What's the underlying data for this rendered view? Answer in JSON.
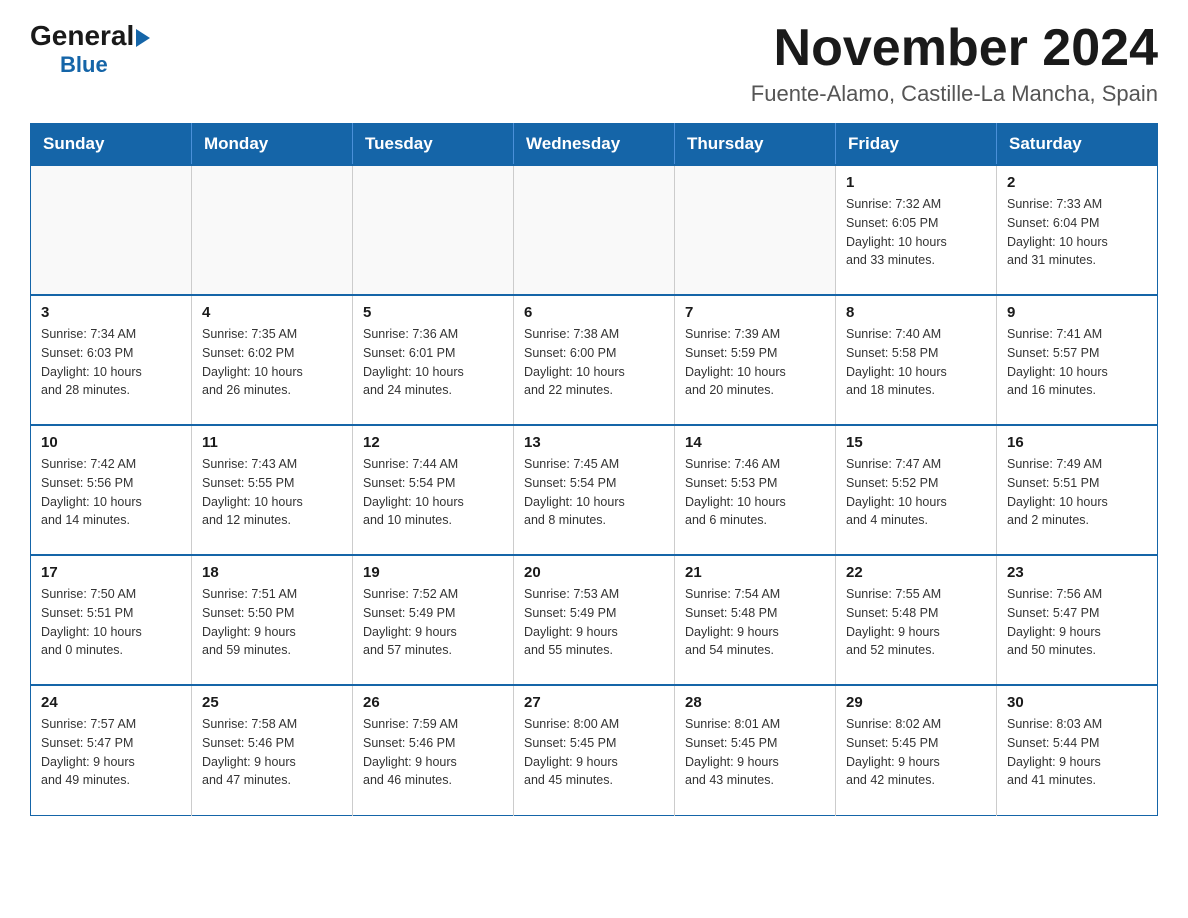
{
  "logo": {
    "general": "General",
    "blue": "Blue"
  },
  "header": {
    "title": "November 2024",
    "subtitle": "Fuente-Alamo, Castille-La Mancha, Spain"
  },
  "weekdays": [
    "Sunday",
    "Monday",
    "Tuesday",
    "Wednesday",
    "Thursday",
    "Friday",
    "Saturday"
  ],
  "weeks": [
    {
      "days": [
        {
          "num": "",
          "info": ""
        },
        {
          "num": "",
          "info": ""
        },
        {
          "num": "",
          "info": ""
        },
        {
          "num": "",
          "info": ""
        },
        {
          "num": "",
          "info": ""
        },
        {
          "num": "1",
          "info": "Sunrise: 7:32 AM\nSunset: 6:05 PM\nDaylight: 10 hours\nand 33 minutes."
        },
        {
          "num": "2",
          "info": "Sunrise: 7:33 AM\nSunset: 6:04 PM\nDaylight: 10 hours\nand 31 minutes."
        }
      ]
    },
    {
      "days": [
        {
          "num": "3",
          "info": "Sunrise: 7:34 AM\nSunset: 6:03 PM\nDaylight: 10 hours\nand 28 minutes."
        },
        {
          "num": "4",
          "info": "Sunrise: 7:35 AM\nSunset: 6:02 PM\nDaylight: 10 hours\nand 26 minutes."
        },
        {
          "num": "5",
          "info": "Sunrise: 7:36 AM\nSunset: 6:01 PM\nDaylight: 10 hours\nand 24 minutes."
        },
        {
          "num": "6",
          "info": "Sunrise: 7:38 AM\nSunset: 6:00 PM\nDaylight: 10 hours\nand 22 minutes."
        },
        {
          "num": "7",
          "info": "Sunrise: 7:39 AM\nSunset: 5:59 PM\nDaylight: 10 hours\nand 20 minutes."
        },
        {
          "num": "8",
          "info": "Sunrise: 7:40 AM\nSunset: 5:58 PM\nDaylight: 10 hours\nand 18 minutes."
        },
        {
          "num": "9",
          "info": "Sunrise: 7:41 AM\nSunset: 5:57 PM\nDaylight: 10 hours\nand 16 minutes."
        }
      ]
    },
    {
      "days": [
        {
          "num": "10",
          "info": "Sunrise: 7:42 AM\nSunset: 5:56 PM\nDaylight: 10 hours\nand 14 minutes."
        },
        {
          "num": "11",
          "info": "Sunrise: 7:43 AM\nSunset: 5:55 PM\nDaylight: 10 hours\nand 12 minutes."
        },
        {
          "num": "12",
          "info": "Sunrise: 7:44 AM\nSunset: 5:54 PM\nDaylight: 10 hours\nand 10 minutes."
        },
        {
          "num": "13",
          "info": "Sunrise: 7:45 AM\nSunset: 5:54 PM\nDaylight: 10 hours\nand 8 minutes."
        },
        {
          "num": "14",
          "info": "Sunrise: 7:46 AM\nSunset: 5:53 PM\nDaylight: 10 hours\nand 6 minutes."
        },
        {
          "num": "15",
          "info": "Sunrise: 7:47 AM\nSunset: 5:52 PM\nDaylight: 10 hours\nand 4 minutes."
        },
        {
          "num": "16",
          "info": "Sunrise: 7:49 AM\nSunset: 5:51 PM\nDaylight: 10 hours\nand 2 minutes."
        }
      ]
    },
    {
      "days": [
        {
          "num": "17",
          "info": "Sunrise: 7:50 AM\nSunset: 5:51 PM\nDaylight: 10 hours\nand 0 minutes."
        },
        {
          "num": "18",
          "info": "Sunrise: 7:51 AM\nSunset: 5:50 PM\nDaylight: 9 hours\nand 59 minutes."
        },
        {
          "num": "19",
          "info": "Sunrise: 7:52 AM\nSunset: 5:49 PM\nDaylight: 9 hours\nand 57 minutes."
        },
        {
          "num": "20",
          "info": "Sunrise: 7:53 AM\nSunset: 5:49 PM\nDaylight: 9 hours\nand 55 minutes."
        },
        {
          "num": "21",
          "info": "Sunrise: 7:54 AM\nSunset: 5:48 PM\nDaylight: 9 hours\nand 54 minutes."
        },
        {
          "num": "22",
          "info": "Sunrise: 7:55 AM\nSunset: 5:48 PM\nDaylight: 9 hours\nand 52 minutes."
        },
        {
          "num": "23",
          "info": "Sunrise: 7:56 AM\nSunset: 5:47 PM\nDaylight: 9 hours\nand 50 minutes."
        }
      ]
    },
    {
      "days": [
        {
          "num": "24",
          "info": "Sunrise: 7:57 AM\nSunset: 5:47 PM\nDaylight: 9 hours\nand 49 minutes."
        },
        {
          "num": "25",
          "info": "Sunrise: 7:58 AM\nSunset: 5:46 PM\nDaylight: 9 hours\nand 47 minutes."
        },
        {
          "num": "26",
          "info": "Sunrise: 7:59 AM\nSunset: 5:46 PM\nDaylight: 9 hours\nand 46 minutes."
        },
        {
          "num": "27",
          "info": "Sunrise: 8:00 AM\nSunset: 5:45 PM\nDaylight: 9 hours\nand 45 minutes."
        },
        {
          "num": "28",
          "info": "Sunrise: 8:01 AM\nSunset: 5:45 PM\nDaylight: 9 hours\nand 43 minutes."
        },
        {
          "num": "29",
          "info": "Sunrise: 8:02 AM\nSunset: 5:45 PM\nDaylight: 9 hours\nand 42 minutes."
        },
        {
          "num": "30",
          "info": "Sunrise: 8:03 AM\nSunset: 5:44 PM\nDaylight: 9 hours\nand 41 minutes."
        }
      ]
    }
  ]
}
